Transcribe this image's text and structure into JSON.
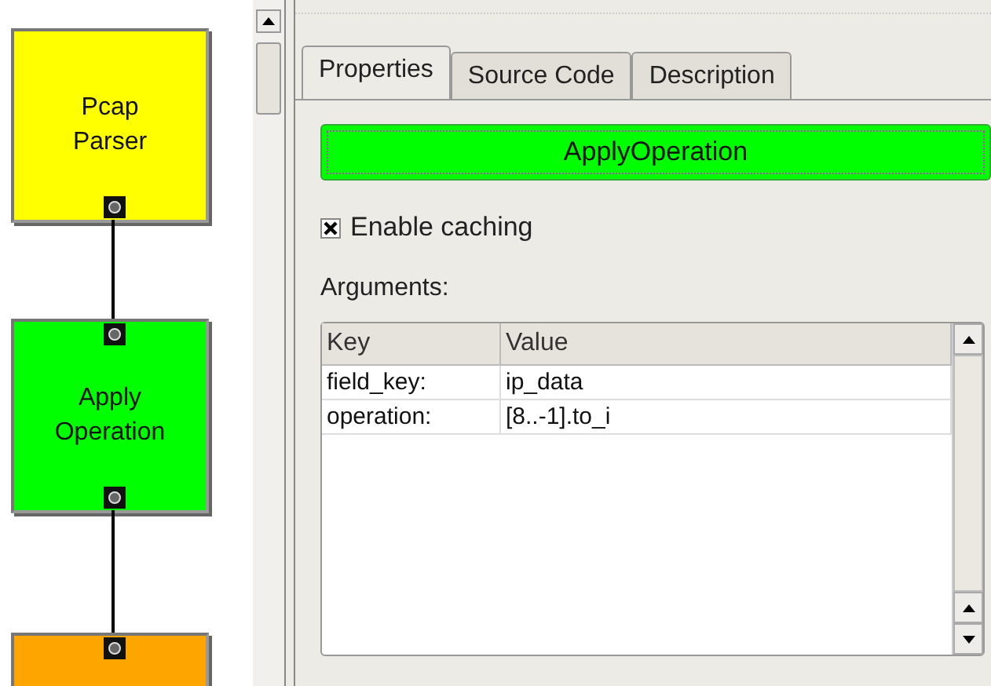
{
  "canvas": {
    "nodes": [
      {
        "label": "Pcap\nParser",
        "color": "#ffff00",
        "ports": [
          {
            "kind": "output"
          }
        ]
      },
      {
        "label": "Apply\nOperation",
        "color": "#00ff00",
        "ports": [
          {
            "kind": "input"
          },
          {
            "kind": "output"
          }
        ]
      },
      {
        "color": "#ffa500",
        "ports": [
          {
            "kind": "input"
          }
        ]
      }
    ]
  },
  "tabs": [
    {
      "label": "Properties",
      "selected": true
    },
    {
      "label": "Source Code",
      "selected": false
    },
    {
      "label": "Description",
      "selected": false
    }
  ],
  "name_button": {
    "label": "ApplyOperation",
    "color": "#00ff00"
  },
  "caching": {
    "label": "Enable caching",
    "checked": true
  },
  "arguments": {
    "label": "Arguments:",
    "columns": [
      "Key",
      "Value"
    ],
    "rows": [
      [
        "field_key:",
        "ip_data"
      ],
      [
        "operation:",
        "[8..-1].to_i"
      ]
    ]
  }
}
